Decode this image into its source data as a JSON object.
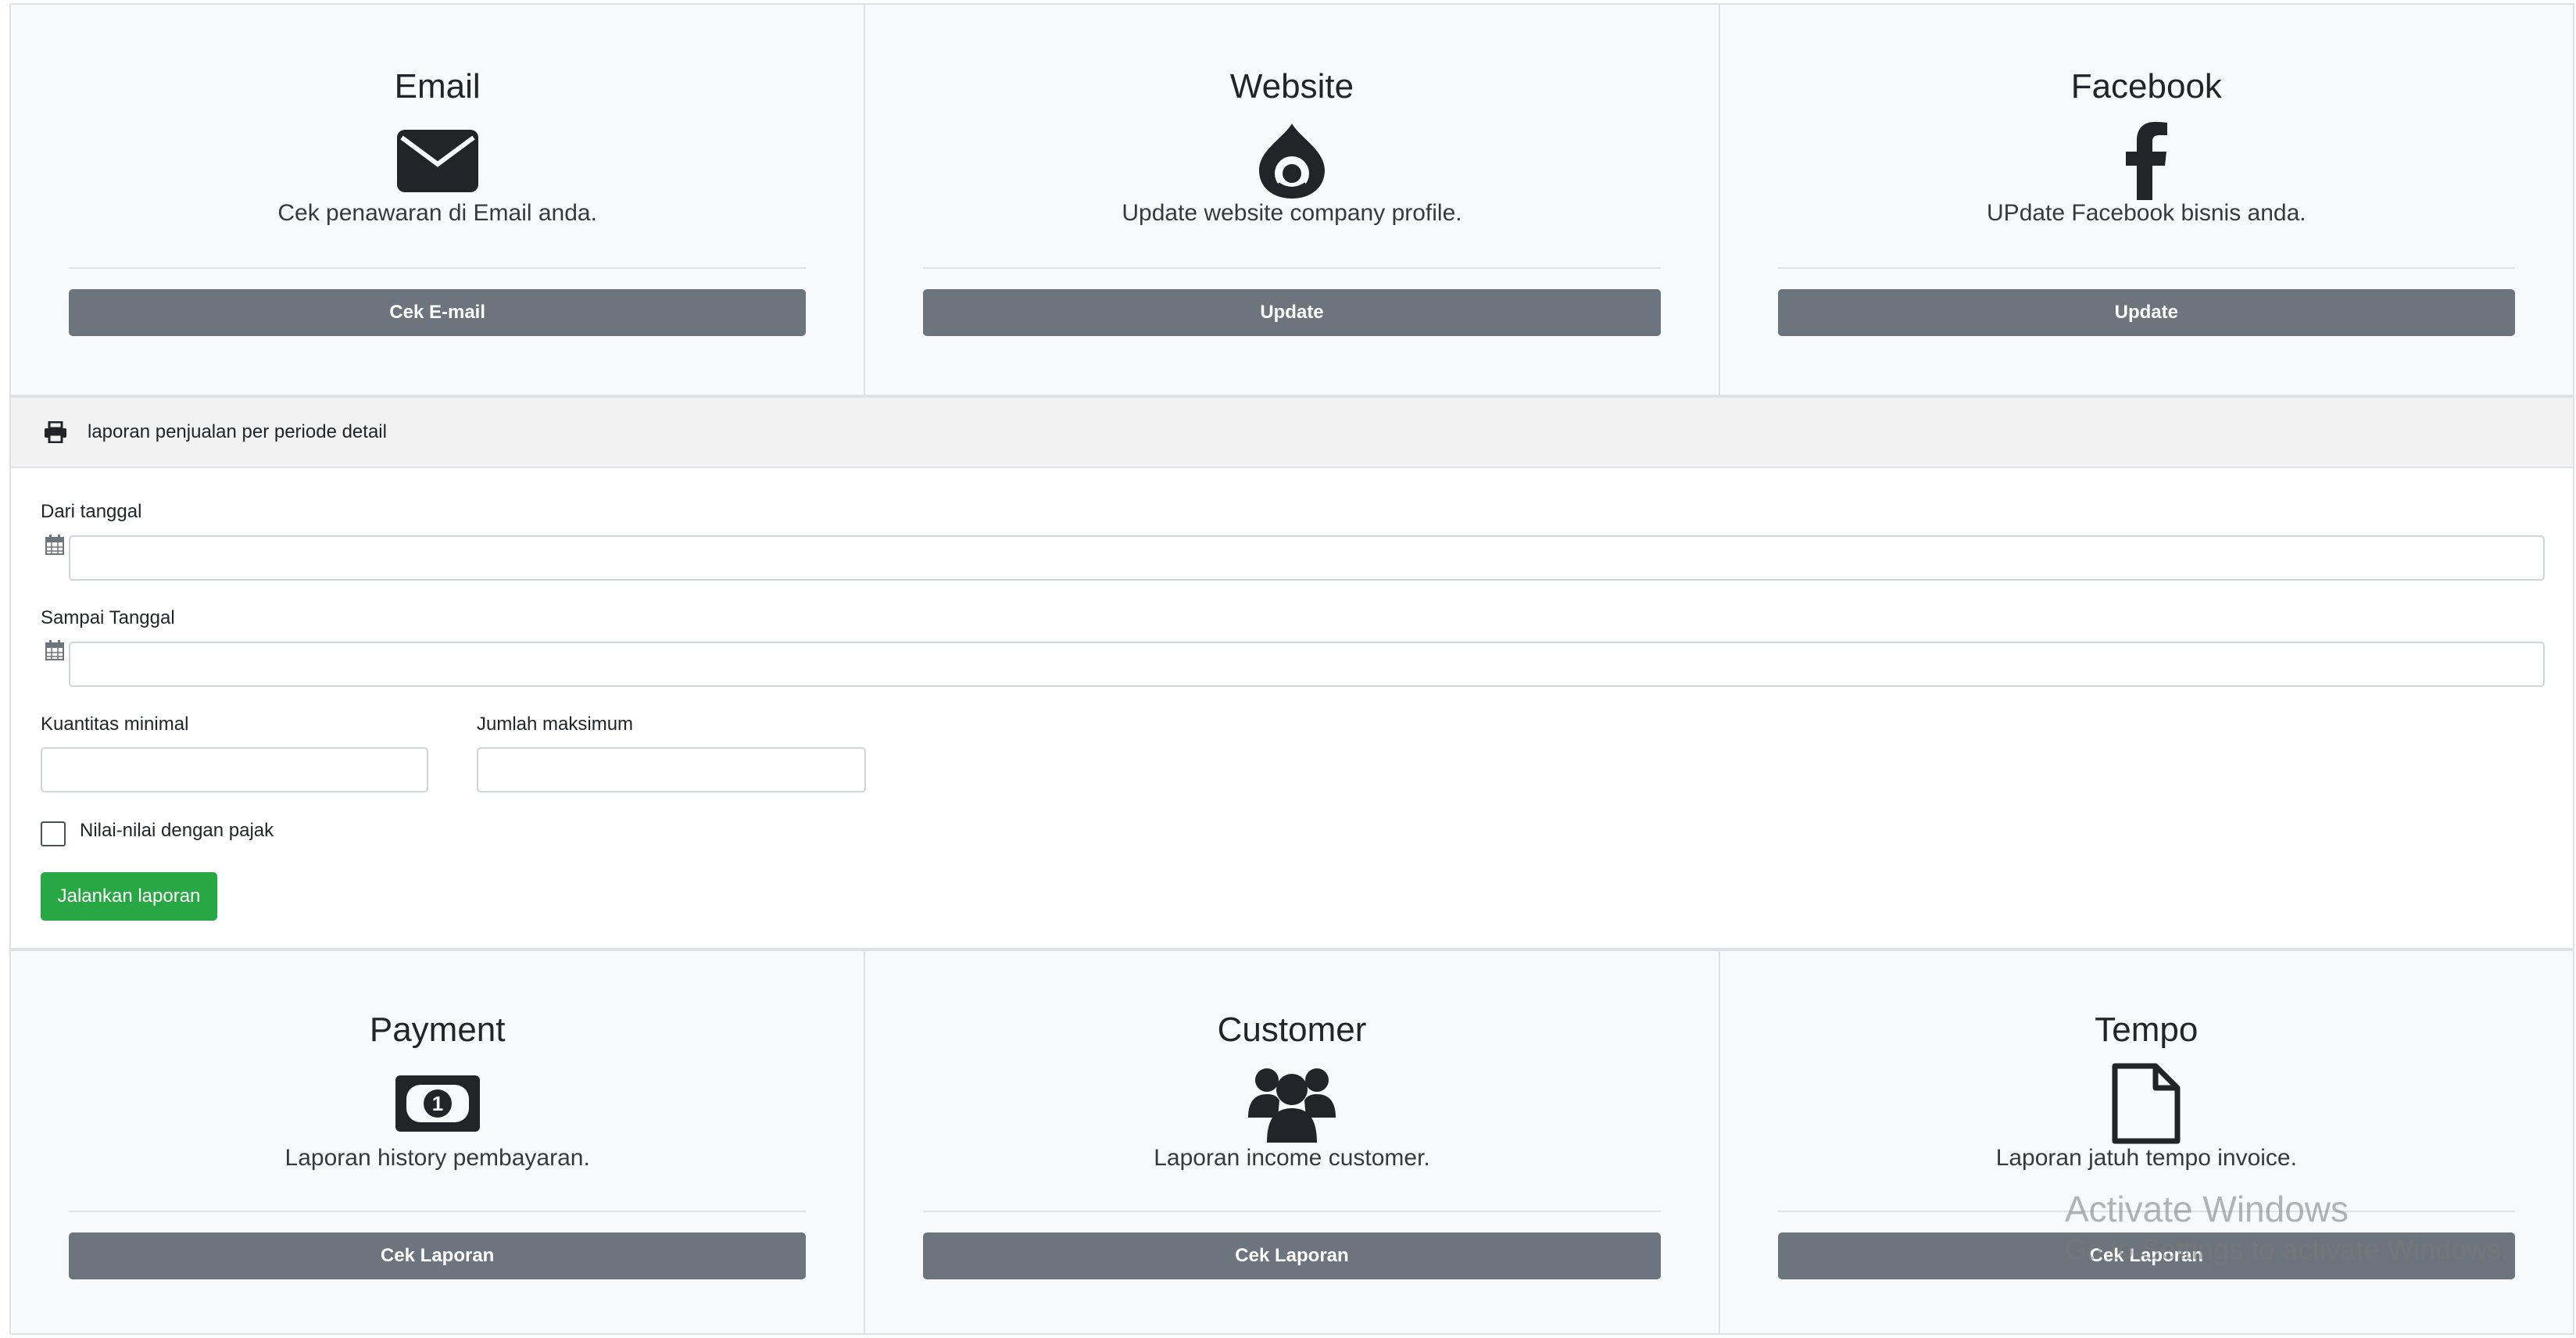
{
  "top_cards": [
    {
      "title": "Email",
      "icon": "envelope-icon",
      "text": "Cek penawaran di Email anda.",
      "button": "Cek E-mail"
    },
    {
      "title": "Website",
      "icon": "drupal-icon",
      "text": "Update website company profile.",
      "button": "Update"
    },
    {
      "title": "Facebook",
      "icon": "facebook-icon",
      "text": "UPdate Facebook bisnis anda.",
      "button": "Update"
    }
  ],
  "report": {
    "header_icon": "printer-icon",
    "title": "laporan penjualan per periode detail",
    "from_date_label": "Dari tanggal",
    "from_date_value": "",
    "to_date_label": "Sampai Tanggal",
    "to_date_value": "",
    "min_qty_label": "Kuantitas minimal",
    "min_qty_value": "",
    "max_amount_label": "Jumlah maksimum",
    "max_amount_value": "",
    "tax_checkbox_label": "Nilai-nilai dengan pajak",
    "tax_checked": false,
    "run_button": "Jalankan laporan"
  },
  "bottom_cards": [
    {
      "title": "Payment",
      "icon": "money-bill-icon",
      "text": "Laporan history pembayaran.",
      "button": "Cek Laporan"
    },
    {
      "title": "Customer",
      "icon": "users-icon",
      "text": "Laporan income customer.",
      "button": "Cek Laporan"
    },
    {
      "title": "Tempo",
      "icon": "file-icon",
      "text": "Laporan jatuh tempo invoice.",
      "button": "Cek Laporan"
    }
  ],
  "watermark": {
    "line1": "Activate Windows",
    "line2": "Go to Settings to activate Windows."
  },
  "colors": {
    "button_gray": "#6c757d",
    "button_green": "#28a745",
    "card_bg": "#f8f9fa",
    "border": "#dee2e6"
  }
}
